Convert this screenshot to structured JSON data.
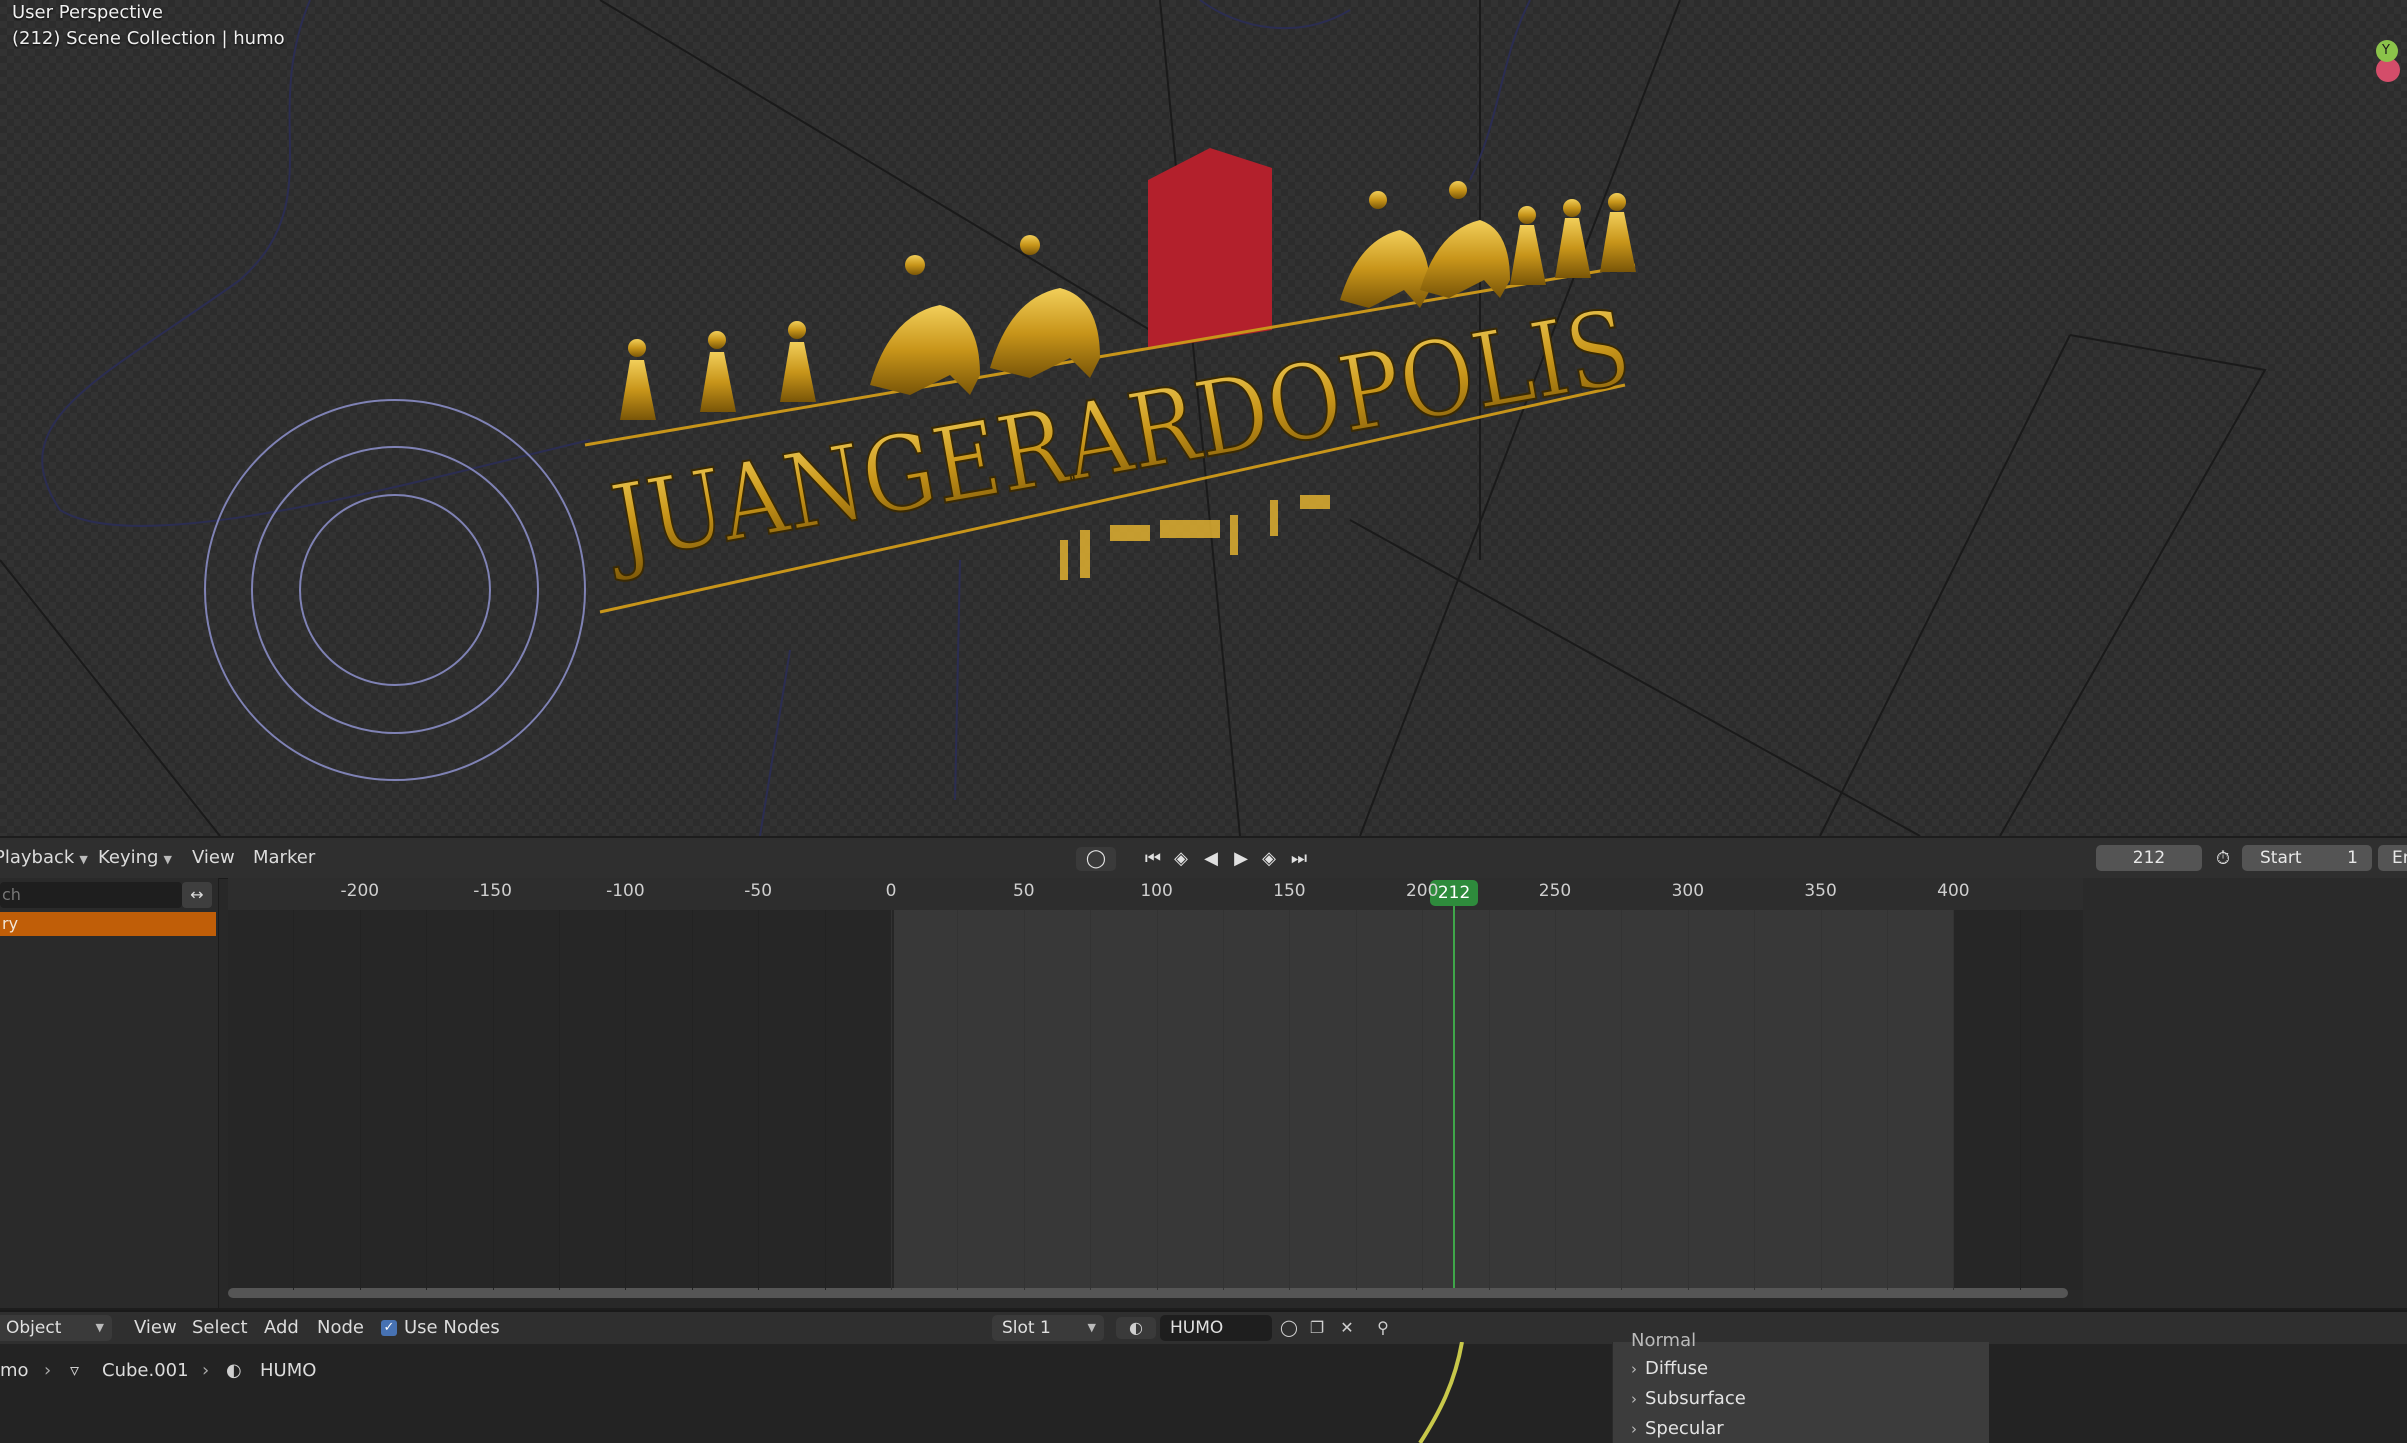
{
  "viewport": {
    "view_name": "User Perspective",
    "collection_info": "(212) Scene Collection | humo",
    "gizmo_y_label": "Y",
    "logo_text": "JUANGERARDOPOLIS"
  },
  "timeline": {
    "menus": [
      "Playback",
      "Keying",
      "View",
      "Marker"
    ],
    "current_frame": "212",
    "start_label": "Start",
    "start_value": "1",
    "end_label": "En",
    "search_placeholder": "ch",
    "summary_label": "ry",
    "ruler_ticks": [
      "-200",
      "-150",
      "-100",
      "-50",
      "0",
      "50",
      "100",
      "150",
      "200",
      "250",
      "300",
      "350",
      "400"
    ],
    "playhead_frame": "212"
  },
  "node_editor": {
    "object_mode": "Object",
    "menus": [
      "View",
      "Select",
      "Add",
      "Node"
    ],
    "use_nodes_label": "Use Nodes",
    "use_nodes_checked": true,
    "slot": "Slot 1",
    "material_name": "HUMO",
    "breadcrumb": [
      "mo",
      "Cube.001",
      "HUMO"
    ],
    "panel_header": "Normal",
    "panel_items": [
      "Diffuse",
      "Subsurface",
      "Specular"
    ]
  },
  "colors": {
    "accent_orange": "#c05e08",
    "playhead_green": "#2e8b3c",
    "checkbox_blue": "#4772b3",
    "logo_gold": "#d4a21e",
    "banner_red": "#b3202c"
  }
}
